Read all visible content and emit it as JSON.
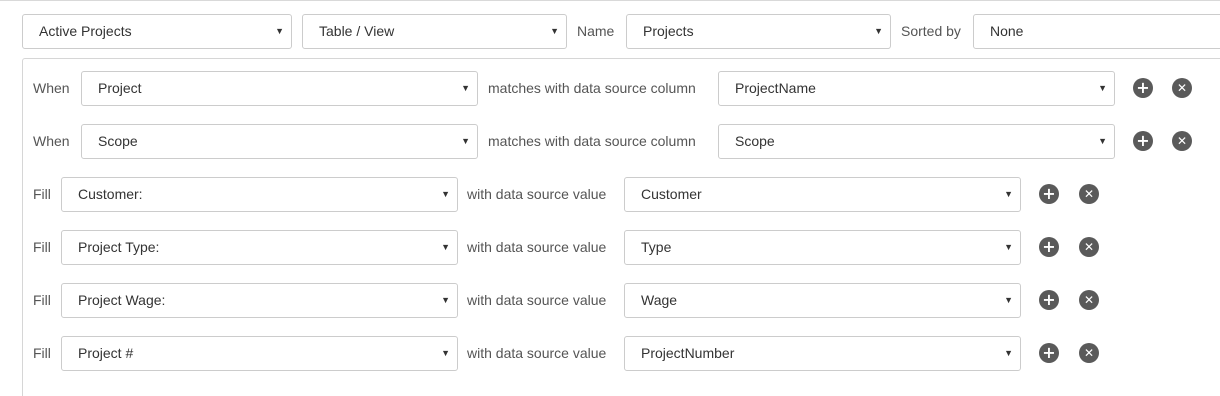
{
  "top": {
    "view_select": "Active Projects",
    "type_select": "Table / View",
    "name_label": "Name",
    "name_select": "Projects",
    "sorted_label": "Sorted by",
    "sorted_select": "None"
  },
  "rules": [
    {
      "kind": "When",
      "field": "Project",
      "connector": "matches with data source column",
      "source": "ProjectName"
    },
    {
      "kind": "When",
      "field": "Scope",
      "connector": "matches with data source column",
      "source": "Scope"
    },
    {
      "kind": "Fill",
      "field": "Customer:",
      "connector": "with data source value",
      "source": "Customer"
    },
    {
      "kind": "Fill",
      "field": "Project Type:",
      "connector": "with data source value",
      "source": "Type"
    },
    {
      "kind": "Fill",
      "field": "Project Wage:",
      "connector": "with data source value",
      "source": "Wage"
    },
    {
      "kind": "Fill",
      "field": "Project #",
      "connector": "with data source value",
      "source": "ProjectNumber"
    }
  ],
  "icons": {
    "dropdown": "caret-down-icon",
    "add": "plus-circle-icon",
    "remove": "x-circle-icon"
  },
  "colors": {
    "border": "#cccccc",
    "icon_fill": "#5a5a5a",
    "label_text": "#555555"
  }
}
